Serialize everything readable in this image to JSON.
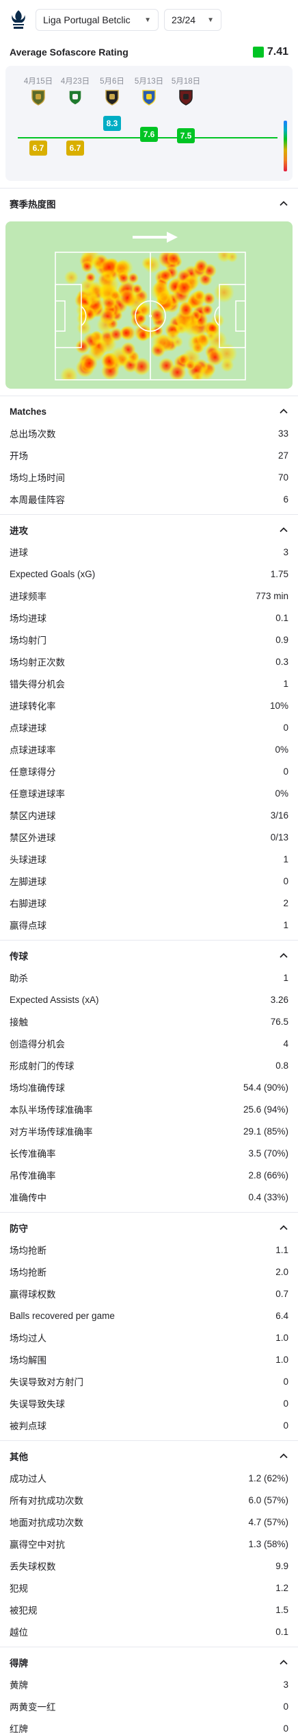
{
  "topbar": {
    "league": "Liga Portugal Betclic",
    "season": "23/24"
  },
  "rating": {
    "title": "Average Sofascore Rating",
    "average": "7.41",
    "matches": [
      {
        "date": "4月15日",
        "rating": "6.7",
        "value": 6.7,
        "color": "#d9af00",
        "logo": "eagle-team-logo"
      },
      {
        "date": "4月23日",
        "rating": "6.7",
        "value": 6.7,
        "color": "#d9af00",
        "logo": "green-white-shield-logo"
      },
      {
        "date": "5月6日",
        "rating": "8.3",
        "value": 8.3,
        "color": "#00adc4",
        "logo": "black-gold-shield-logo"
      },
      {
        "date": "5月13日",
        "rating": "7.6",
        "value": 7.6,
        "color": "#00c424",
        "logo": "blue-yellow-crest-logo"
      },
      {
        "date": "5月18日",
        "rating": "7.5",
        "value": 7.5,
        "color": "#00c424",
        "logo": "dark-red-crest-logo"
      }
    ]
  },
  "heatmap": {
    "title": "赛季热度图"
  },
  "sections": [
    {
      "title": "Matches",
      "rows": [
        {
          "label": "总出场次数",
          "value": "33"
        },
        {
          "label": "开场",
          "value": "27"
        },
        {
          "label": "场均上场时间",
          "value": "70"
        },
        {
          "label": "本周最佳阵容",
          "value": "6"
        }
      ]
    },
    {
      "title": "进攻",
      "rows": [
        {
          "label": "进球",
          "value": "3"
        },
        {
          "label": "Expected Goals (xG)",
          "value": "1.75"
        },
        {
          "label": "进球频率",
          "value": "773 min"
        },
        {
          "label": "场均进球",
          "value": "0.1"
        },
        {
          "label": "场均射门",
          "value": "0.9"
        },
        {
          "label": "场均射正次数",
          "value": "0.3"
        },
        {
          "label": "错失得分机会",
          "value": "1"
        },
        {
          "label": "进球转化率",
          "value": "10%"
        },
        {
          "label": "点球进球",
          "value": "0"
        },
        {
          "label": "点球进球率",
          "value": "0%"
        },
        {
          "label": "任意球得分",
          "value": "0"
        },
        {
          "label": "任意球进球率",
          "value": "0%"
        },
        {
          "label": "禁区内进球",
          "value": "3/16"
        },
        {
          "label": "禁区外进球",
          "value": "0/13"
        },
        {
          "label": "头球进球",
          "value": "1"
        },
        {
          "label": "左脚进球",
          "value": "0"
        },
        {
          "label": "右脚进球",
          "value": "2"
        },
        {
          "label": "赢得点球",
          "value": "1"
        }
      ]
    },
    {
      "title": "传球",
      "rows": [
        {
          "label": "助杀",
          "value": "1"
        },
        {
          "label": "Expected Assists (xA)",
          "value": "3.26"
        },
        {
          "label": "接触",
          "value": "76.5"
        },
        {
          "label": "创造得分机会",
          "value": "4"
        },
        {
          "label": "形成射门的传球",
          "value": "0.8"
        },
        {
          "label": "场均准确传球",
          "value": "54.4 (90%)"
        },
        {
          "label": "本队半场传球准确率",
          "value": "25.6 (94%)"
        },
        {
          "label": "对方半场传球准确率",
          "value": "29.1 (85%)"
        },
        {
          "label": "长传准确率",
          "value": "3.5 (70%)"
        },
        {
          "label": "吊传准确率",
          "value": "2.8 (66%)"
        },
        {
          "label": "准确传中",
          "value": "0.4 (33%)"
        }
      ]
    },
    {
      "title": "防守",
      "rows": [
        {
          "label": "场均抢断",
          "value": "1.1"
        },
        {
          "label": "场均抢断",
          "value": "2.0"
        },
        {
          "label": "赢得球权数",
          "value": "0.7"
        },
        {
          "label": "Balls recovered per game",
          "value": "6.4"
        },
        {
          "label": "场均过人",
          "value": "1.0"
        },
        {
          "label": "场均解围",
          "value": "1.0"
        },
        {
          "label": "失误导致对方射门",
          "value": "0"
        },
        {
          "label": "失误导致失球",
          "value": "0"
        },
        {
          "label": "被判点球",
          "value": "0"
        }
      ]
    },
    {
      "title": "其他",
      "rows": [
        {
          "label": "成功过人",
          "value": "1.2 (62%)"
        },
        {
          "label": "所有对抗成功次数",
          "value": "6.0 (57%)"
        },
        {
          "label": "地面对抗成功次数",
          "value": "4.7 (57%)"
        },
        {
          "label": "赢得空中对抗",
          "value": "1.3 (58%)"
        },
        {
          "label": "丢失球权数",
          "value": "9.9"
        },
        {
          "label": "犯规",
          "value": "1.2"
        },
        {
          "label": "被犯规",
          "value": "1.5"
        },
        {
          "label": "越位",
          "value": "0.1"
        }
      ]
    },
    {
      "title": "得牌",
      "rows": [
        {
          "label": "黄牌",
          "value": "3"
        },
        {
          "label": "两黄变一红",
          "value": "0"
        },
        {
          "label": "红牌",
          "value": "0"
        }
      ]
    }
  ]
}
